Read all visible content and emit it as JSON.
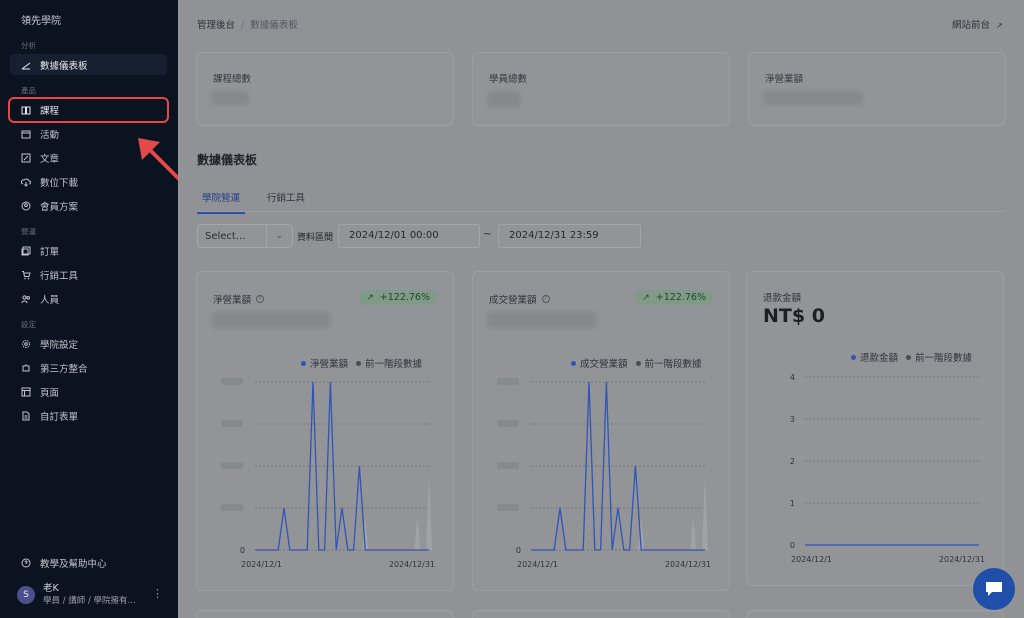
{
  "sidebar": {
    "brand": "領先學院",
    "sections": {
      "analytics": "分析",
      "products": "產品",
      "management": "營運",
      "settings": "設定"
    },
    "items": [
      {
        "label": "數據儀表板",
        "icon": "chart-icon"
      },
      {
        "label": "課程",
        "icon": "book-icon"
      },
      {
        "label": "活動",
        "icon": "calendar-icon"
      },
      {
        "label": "文章",
        "icon": "edit-document-icon"
      },
      {
        "label": "數位下載",
        "icon": "cloud-download-icon"
      },
      {
        "label": "會員方案",
        "icon": "member-icon"
      },
      {
        "label": "訂單",
        "icon": "orders-icon"
      },
      {
        "label": "行銷工具",
        "icon": "cart-icon"
      },
      {
        "label": "人員",
        "icon": "users-icon"
      },
      {
        "label": "學院設定",
        "icon": "gear-icon"
      },
      {
        "label": "第三方整合",
        "icon": "puzzle-icon"
      },
      {
        "label": "頁面",
        "icon": "page-icon"
      },
      {
        "label": "自訂表單",
        "icon": "form-icon"
      }
    ],
    "help": "教學及幫助中心",
    "user": {
      "avatar": "S",
      "name": "老K",
      "role": "學員 / 講師 / 學院擁有..."
    }
  },
  "header": {
    "breadcrumb_root": "管理後台",
    "breadcrumb_sep": "/",
    "breadcrumb_current": "數據儀表板",
    "site_link": "網站前台"
  },
  "stats": [
    {
      "label": "課程總數"
    },
    {
      "label": "學員總數"
    },
    {
      "label": "淨營業額"
    }
  ],
  "dashboard": {
    "title": "數據儀表板",
    "tabs": [
      "學院營運",
      "行銷工具"
    ],
    "select_placeholder": "Select...",
    "range_label": "資料區間",
    "date_from": "2024/12/01 00:00",
    "range_sep": "~",
    "date_to": "2024/12/31 23:59"
  },
  "cards": [
    {
      "title": "淨營業額",
      "badge": "+122.76%",
      "legend_a": "淨營業額",
      "legend_b": "前一階段數據"
    },
    {
      "title": "成交營業額",
      "badge": "+122.76%",
      "legend_a": "成交營業額",
      "legend_b": "前一階段數據"
    },
    {
      "title": "退款金額",
      "value": "NT$ 0",
      "legend_a": "退款金額",
      "legend_b": "前一階段數據"
    }
  ],
  "colors": {
    "series": "#2f55b8",
    "previous": "#4a4d52",
    "highlight": "#e54848",
    "badge_bg": "#7f9a86",
    "fab": "#1f4fa8"
  },
  "chart_data": [
    {
      "type": "line",
      "title": "淨營業額",
      "x_start": "2024/12/1",
      "x_end": "2024/12/31",
      "x_tick_labels": [
        "2024/12/1",
        "2024/12/31"
      ],
      "y_visible_ticks": [
        0
      ],
      "series": [
        {
          "name": "淨營業額",
          "values": [
            0,
            0,
            0,
            0,
            0,
            1,
            0,
            0,
            0,
            0,
            4,
            0,
            0,
            4,
            0,
            1,
            0,
            0,
            2,
            0,
            0,
            0,
            0,
            0,
            0,
            0,
            0,
            0,
            0,
            0,
            0
          ]
        },
        {
          "name": "前一階段數據",
          "values": [
            0,
            0,
            0,
            0,
            0,
            0,
            0,
            0,
            0,
            0,
            0,
            0,
            0,
            0,
            0,
            0,
            0,
            0,
            0,
            0.8,
            0,
            0,
            0,
            0,
            0,
            0,
            0,
            0,
            0.8,
            0,
            1.8
          ]
        }
      ]
    },
    {
      "type": "line",
      "title": "成交營業額",
      "x_start": "2024/12/1",
      "x_end": "2024/12/31",
      "x_tick_labels": [
        "2024/12/1",
        "2024/12/31"
      ],
      "y_visible_ticks": [
        0
      ],
      "series": [
        {
          "name": "成交營業額",
          "values": [
            0,
            0,
            0,
            0,
            0,
            1,
            0,
            0,
            0,
            0,
            4,
            0,
            0,
            4,
            0,
            1,
            0,
            0,
            2,
            0,
            0,
            0,
            0,
            0,
            0,
            0,
            0,
            0,
            0,
            0,
            0
          ]
        },
        {
          "name": "前一階段數據",
          "values": [
            0,
            0,
            0,
            0,
            0,
            0,
            0,
            0,
            0,
            0,
            0,
            0,
            0,
            0,
            0,
            0,
            0,
            0,
            0,
            0.8,
            0,
            0,
            0,
            0,
            0,
            0,
            0,
            0,
            0.8,
            0,
            1.8
          ]
        }
      ]
    },
    {
      "type": "line",
      "title": "退款金額",
      "x_start": "2024/12/1",
      "x_end": "2024/12/31",
      "x_tick_labels": [
        "2024/12/1",
        "2024/12/31"
      ],
      "ylim": [
        0,
        4
      ],
      "y_ticks": [
        0,
        1,
        2,
        3,
        4
      ],
      "series": [
        {
          "name": "退款金額",
          "values": [
            0,
            0,
            0,
            0,
            0,
            0,
            0,
            0,
            0,
            0,
            0,
            0,
            0,
            0,
            0,
            0,
            0,
            0,
            0,
            0,
            0,
            0,
            0,
            0,
            0,
            0,
            0,
            0,
            0,
            0,
            0
          ]
        }
      ]
    }
  ]
}
